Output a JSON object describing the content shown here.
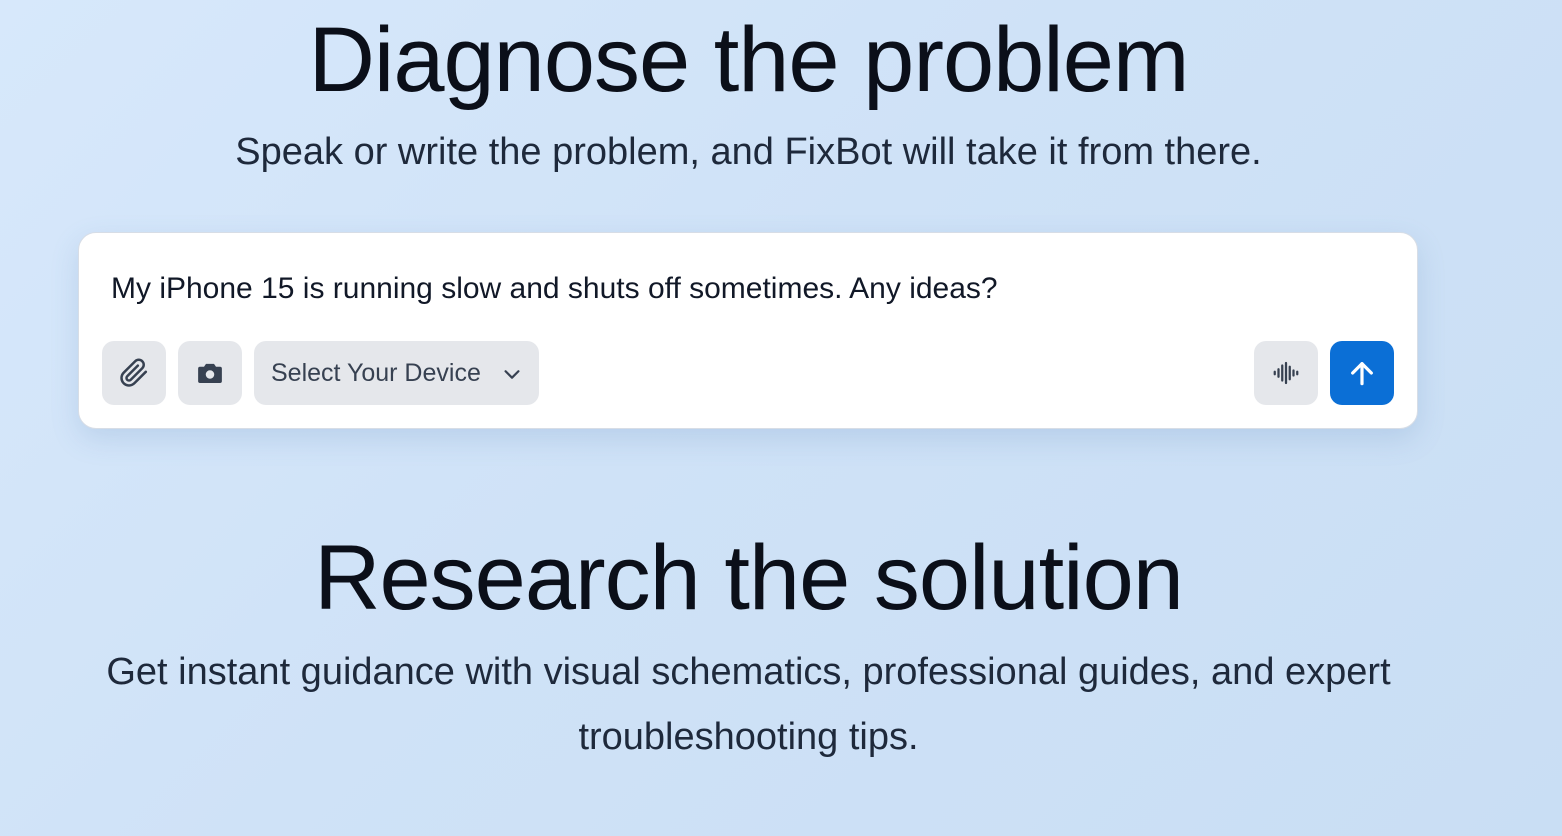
{
  "diagnose": {
    "title": "Diagnose the problem",
    "subtitle": "Speak or write the problem, and FixBot will take it from there."
  },
  "composer": {
    "input_value": "My iPhone 15 is running slow and shuts off sometimes. Any ideas?",
    "device_select_label": "Select Your Device",
    "icons": {
      "attach": "paperclip-icon",
      "camera": "camera-icon",
      "dropdown": "chevron-down-icon",
      "voice": "audio-waveform-icon",
      "send": "arrow-up-icon"
    },
    "colors": {
      "send_button": "#0b6fd6",
      "tool_button": "#e5e7eb"
    }
  },
  "research": {
    "title": "Research the solution",
    "subtitle": "Get instant guidance with visual schematics, professional guides, and expert troubleshooting tips."
  },
  "theme": {
    "background": "#d2e5f8",
    "text": "#0b0f19"
  }
}
